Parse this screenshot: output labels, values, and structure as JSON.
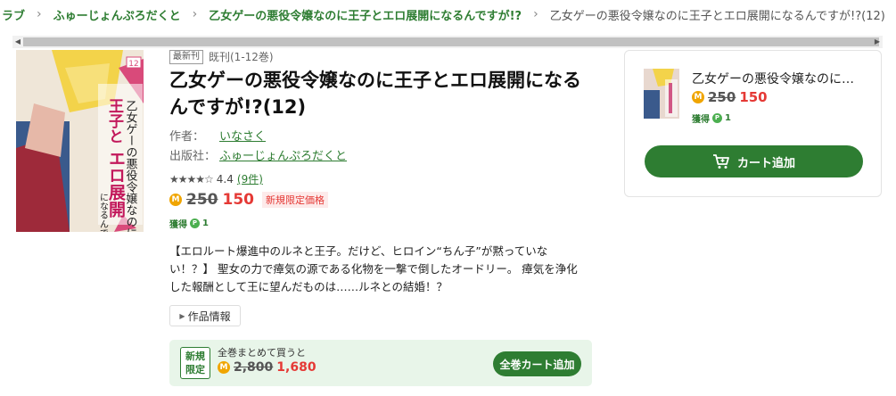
{
  "breadcrumb": {
    "items": [
      "ラブ",
      "ふゅーじょんぷろだくと",
      "乙女ゲーの悪役令嬢なのに王子とエロ展開になるんですが!?"
    ],
    "current": "乙女ゲーの悪役令嬢なのに王子とエロ展開になるんですが!?(12)"
  },
  "book": {
    "badge": "最新刊",
    "volumes": "既刊(1-12巻)",
    "title": "乙女ゲーの悪役令嬢なのに王子とエロ展開になるんですが!?(12)",
    "author_label": "作者：",
    "author": "いなさく",
    "publisher_label": "出版社：",
    "publisher": "ふゅーじょんぷろだくと",
    "rating": "4.4",
    "review_count": "(9件)",
    "rating_stars": 4.4,
    "coin_icon": "M",
    "price_old": "250",
    "price_new": "150",
    "limited_tag": "新規限定価格",
    "points_label": "獲得",
    "points_icon": "P",
    "points": "1",
    "description": "【エロルート爆進中のルネと王子。だけど、ヒロイン“ちん子”が黙っていない！？】 聖女の力で瘴気の源である化物を一撃で倒したオードリー。 瘴気を浄化した報酬として王に望んだものは……ルネとの結婚！？",
    "work_info": "作品情報"
  },
  "cover": {
    "vol": "12",
    "title_text": "乙女ゲーの悪役令嬢なのに王子とエロ展開になるんですが!?"
  },
  "bundle": {
    "tag_line1": "新規",
    "tag_line2": "限定",
    "label": "全巻まとめて買うと",
    "price_old": "2,800",
    "price_new": "1,680",
    "button": "全巻カート追加"
  },
  "cart_panel": {
    "title": "乙女ゲーの悪役令嬢なのに…",
    "price_old": "250",
    "price_new": "150",
    "points_label": "獲得",
    "points": "1",
    "button": "カート追加"
  },
  "colors": {
    "accent": "#2e7d32",
    "sale": "#e53935",
    "coin": "#f0a500"
  }
}
